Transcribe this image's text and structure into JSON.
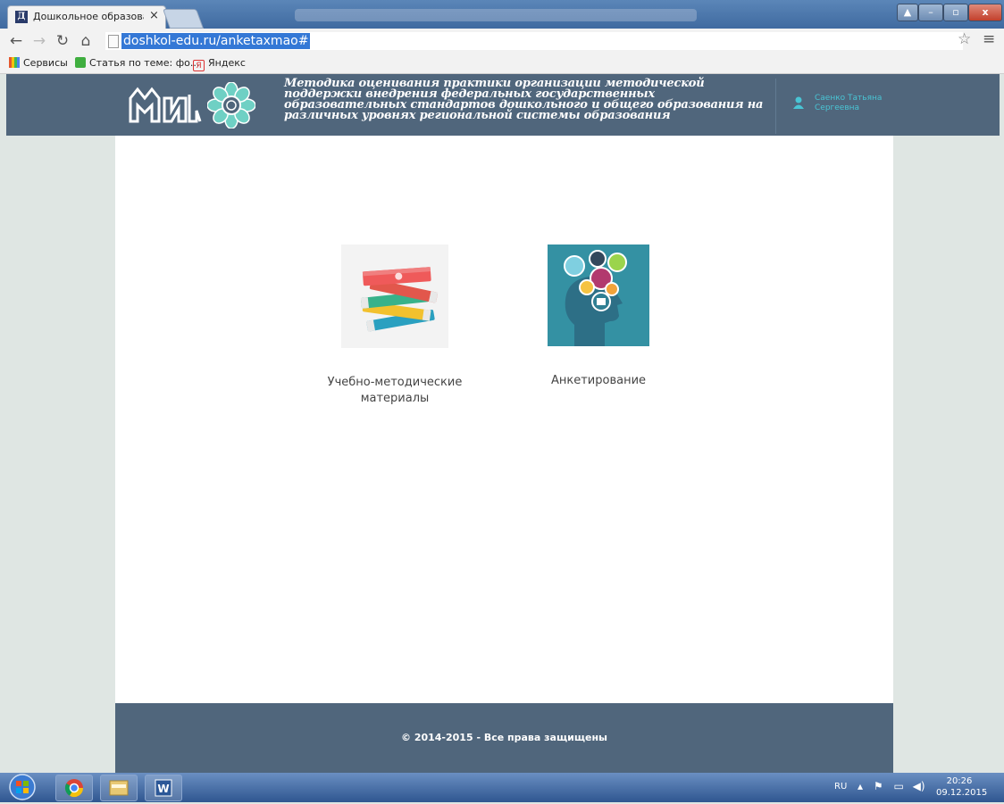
{
  "browser": {
    "tab_title": "Дошкольное образовани",
    "tab_close": "×",
    "favicon_letter": "Д",
    "url": "doshkol-edu.ru/anketaxmao#",
    "bookmarks": [
      {
        "label": "Сервисы"
      },
      {
        "label": "Статья по теме: фо..."
      },
      {
        "label": "Яндекс"
      }
    ]
  },
  "header": {
    "title": "Методика оценивания практики организации методической поддержки внедрения федеральных государственных образовательных стандартов дошкольного и общего образования на различных уровнях региональной системы образования",
    "user_name": "Саенко Татьяна Сергеевна"
  },
  "main": {
    "cards": [
      {
        "label": "Учебно-методические материалы",
        "icon": "books-icon"
      },
      {
        "label": "Анкетирование",
        "icon": "head-survey-icon"
      }
    ]
  },
  "footer": {
    "copyright": "© 2014-2015 - Все права защищены"
  },
  "taskbar": {
    "lang": "RU",
    "time": "20:26",
    "date": "09.12.2015"
  },
  "colors": {
    "header_bg": "#50667c",
    "accent": "#49c4d4",
    "page_bg": "#dfe6e3"
  }
}
